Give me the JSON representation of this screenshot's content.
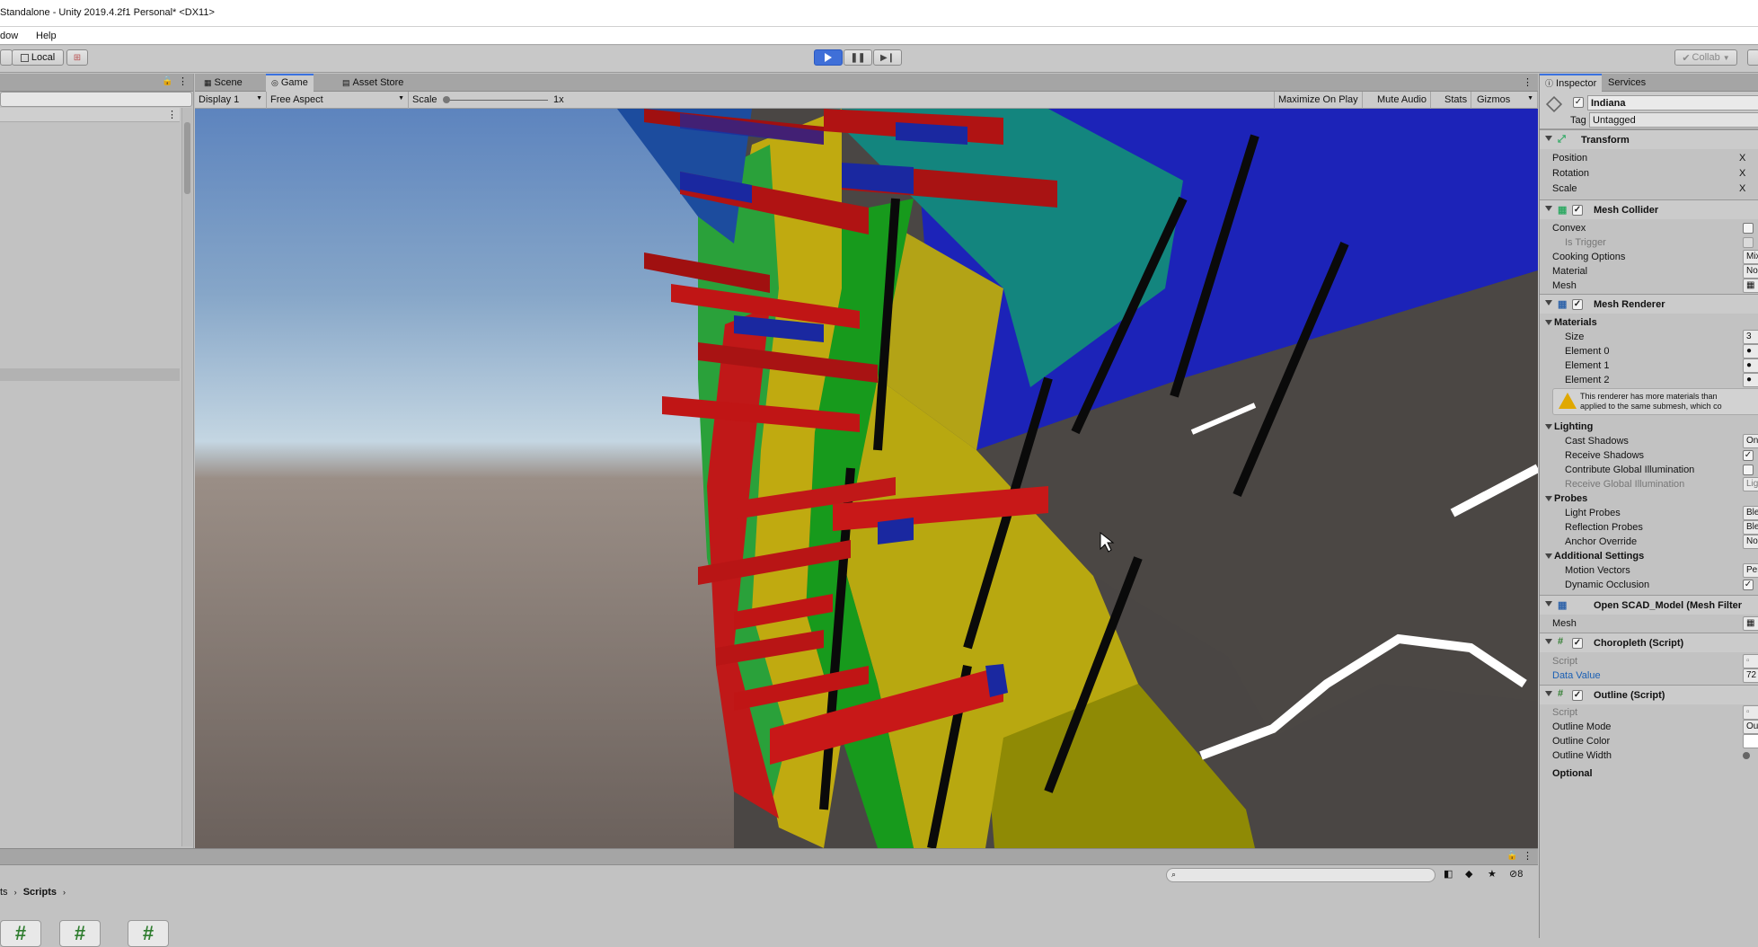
{
  "window": {
    "title": "Standalone - Unity 2019.4.2f1 Personal* <DX11>"
  },
  "menu": {
    "items": [
      "dow",
      "Help"
    ]
  },
  "toolbar": {
    "local_label": "Local",
    "collab_label": "Collab"
  },
  "game_tabs": [
    "Scene",
    "Game",
    "Asset Store"
  ],
  "game_bar": {
    "display": "Display 1",
    "aspect": "Free Aspect",
    "scale_label": "Scale",
    "scale_value": "1x",
    "maximize": "Maximize On Play",
    "mute": "Mute Audio",
    "stats": "Stats",
    "gizmos": "Gizmos"
  },
  "inspector": {
    "tabs": [
      "Inspector",
      "Services"
    ],
    "object_name": "Indiana",
    "tag_label": "Tag",
    "tag_value": "Untagged",
    "transform": {
      "title": "Transform",
      "position": "Position",
      "rotation": "Rotation",
      "scale": "Scale"
    },
    "mesh_collider": {
      "title": "Mesh Collider",
      "convex": "Convex",
      "is_trigger": "Is Trigger",
      "cooking": "Cooking Options",
      "material": "Material",
      "mesh": "Mesh",
      "cooking_value": "Mix",
      "material_value": "Nor"
    },
    "mesh_renderer": {
      "title": "Mesh Renderer",
      "materials": "Materials",
      "size": "Size",
      "size_value": "3",
      "element0": "Element 0",
      "element1": "Element 1",
      "element2": "Element 2",
      "warning": "This renderer has more materials than",
      "warning2": "applied to the same submesh, which co",
      "lighting": "Lighting",
      "cast_shadows": "Cast Shadows",
      "cast_value": "On",
      "receive_shadows": "Receive Shadows",
      "contribute_gi": "Contribute Global Illumination",
      "receive_gi": "Receive Global Illumination",
      "receive_gi_value": "Lig",
      "probes": "Probes",
      "light_probes": "Light Probes",
      "reflection_probes": "Reflection Probes",
      "anchor_override": "Anchor Override",
      "ble": "Ble",
      "nor": "Nor",
      "additional": "Additional Settings",
      "motion_vectors": "Motion Vectors",
      "motion_value": "Per",
      "dynamic_occlusion": "Dynamic Occlusion"
    },
    "mesh_filter": {
      "title": "Open SCAD_Model (Mesh Filter",
      "mesh": "Mesh"
    },
    "choropleth": {
      "title": "Choropleth (Script)",
      "script": "Script",
      "data_value": "Data Value",
      "data_value_num": "72"
    },
    "outline": {
      "title": "Outline (Script)",
      "script": "Script",
      "mode": "Outline Mode",
      "mode_value": "Ou",
      "color": "Outline Color",
      "width": "Outline Width",
      "optional": "Optional"
    }
  },
  "bottom": {
    "breadcrumb_prefix": "ts",
    "breadcrumb": "Scripts",
    "hidden_count": "8"
  },
  "colors": {
    "accent": "#3a72e0",
    "play_active": "#3f6fd8"
  }
}
